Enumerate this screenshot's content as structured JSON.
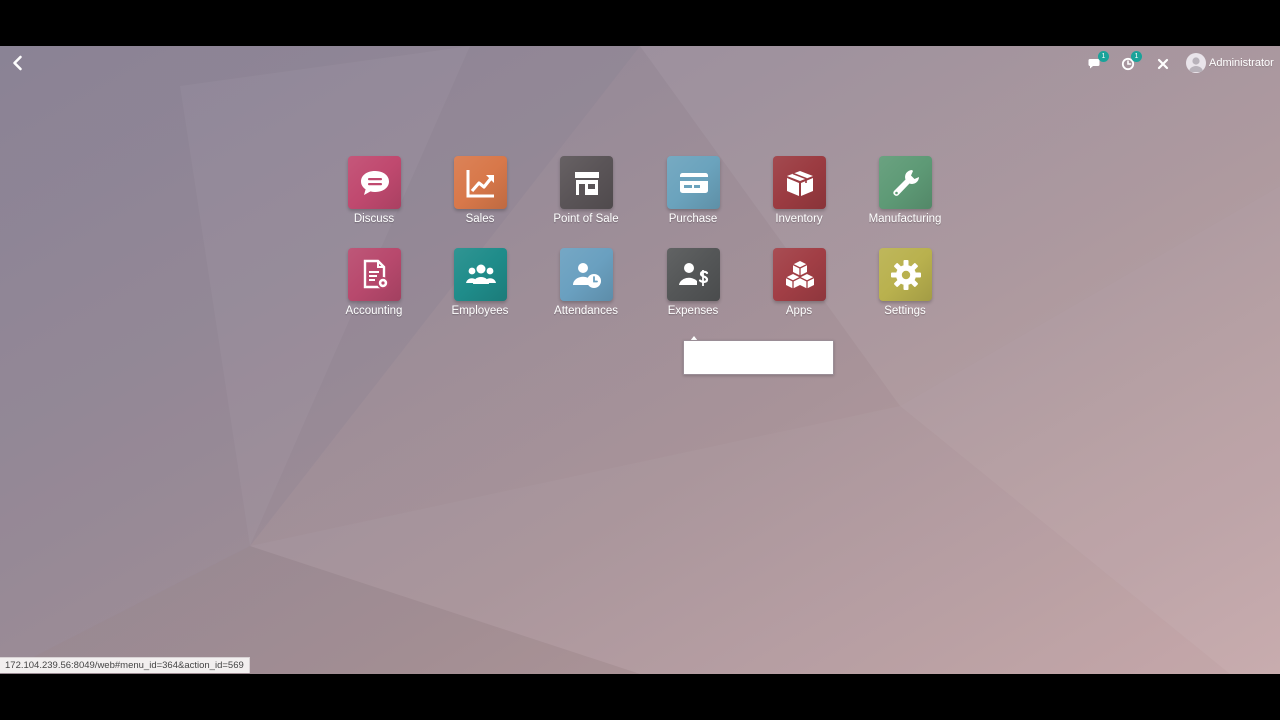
{
  "topbar": {
    "back_icon": "chevron-left-icon",
    "messages": {
      "icon": "chat-bubbles-icon",
      "count": "1"
    },
    "activities": {
      "icon": "clock-activity-icon",
      "count": "1"
    },
    "close_icon": "close-icon",
    "user": {
      "name": "Administrator",
      "icon": "user-avatar-icon"
    }
  },
  "apps": [
    {
      "label": "Discuss",
      "icon": "chat-bubble-icon",
      "color": "#c0496f"
    },
    {
      "label": "Sales",
      "icon": "trend-chart-icon",
      "color": "#d8784a"
    },
    {
      "label": "Point of Sale",
      "icon": "store-icon",
      "color": "#5a5457"
    },
    {
      "label": "Purchase",
      "icon": "credit-card-icon",
      "color": "#6ba3bd"
    },
    {
      "label": "Inventory",
      "icon": "box-icon",
      "color": "#9b3b41"
    },
    {
      "label": "Manufacturing",
      "icon": "wrench-icon",
      "color": "#5e9a76"
    },
    {
      "label": "Accounting",
      "icon": "invoice-gear-icon",
      "color": "#b8496d"
    },
    {
      "label": "Employees",
      "icon": "users-group-icon",
      "color": "#1f8c8a"
    },
    {
      "label": "Attendances",
      "icon": "user-clock-icon",
      "color": "#6aa0c0"
    },
    {
      "label": "Expenses",
      "icon": "user-dollar-icon",
      "color": "#545657"
    },
    {
      "label": "Apps",
      "icon": "cubes-icon",
      "color": "#a13e45"
    },
    {
      "label": "Settings",
      "icon": "gear-icon",
      "color": "#b9b14e"
    }
  ],
  "status_bar": {
    "url": "172.104.239.56:8049/web#menu_id=364&action_id=569"
  }
}
